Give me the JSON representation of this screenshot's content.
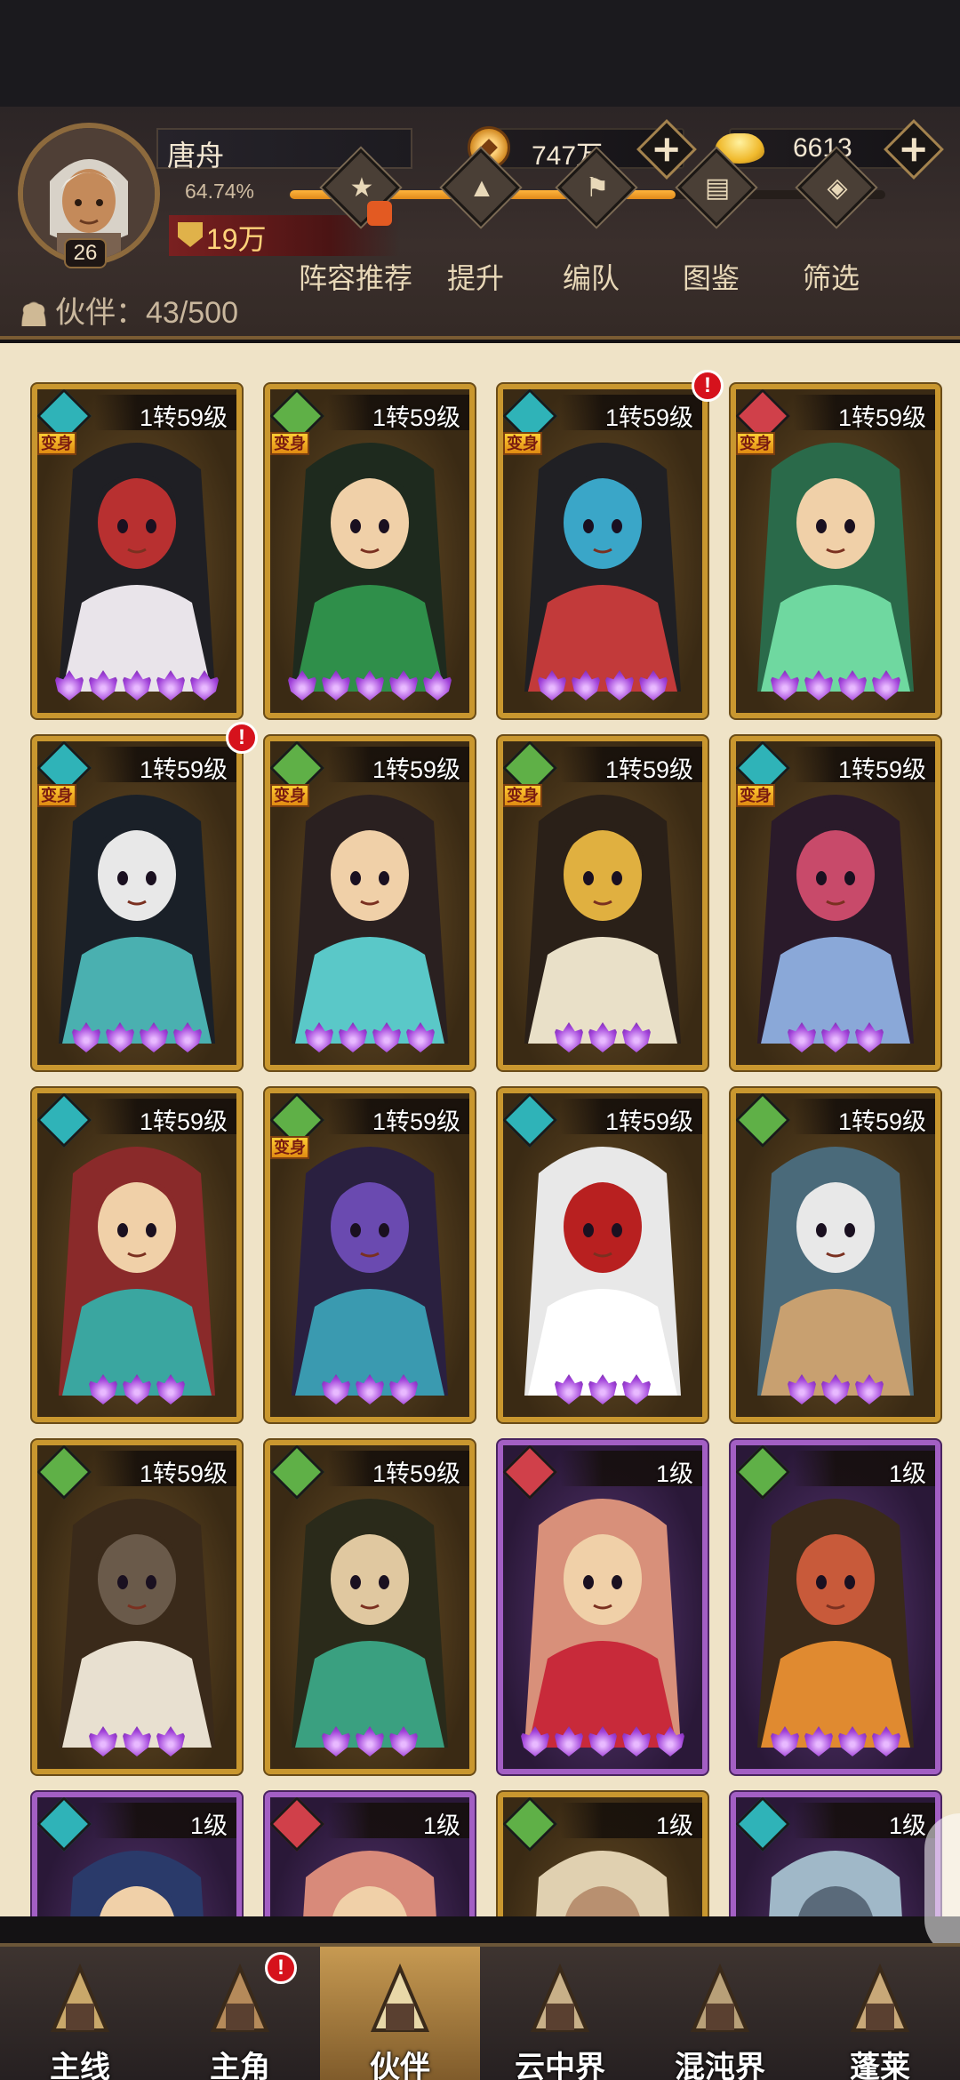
{
  "player": {
    "name": "唐舟",
    "level": "26",
    "exp_percent": "64.74%",
    "exp_fraction": 0.6474,
    "power": "19万"
  },
  "currency": {
    "coins": "747万",
    "ingots": "6613"
  },
  "partners": {
    "label": "伙伴：43/500"
  },
  "actions": [
    {
      "label": "阵容推荐",
      "icon": "recommend-icon"
    },
    {
      "label": "提升",
      "icon": "upgrade-icon"
    },
    {
      "label": "编队",
      "icon": "formation-icon"
    },
    {
      "label": "图鉴",
      "icon": "codex-icon"
    },
    {
      "label": "筛选",
      "icon": "filter-icon"
    }
  ],
  "cards": [
    {
      "level": "1转59级",
      "element": "cyan",
      "transform": "变身",
      "stars": 5,
      "rarity": "gold",
      "alert": false
    },
    {
      "level": "1转59级",
      "element": "green",
      "transform": "变身",
      "stars": 5,
      "rarity": "gold",
      "alert": false
    },
    {
      "level": "1转59级",
      "element": "cyan",
      "transform": "变身",
      "stars": 4,
      "rarity": "gold",
      "alert": true
    },
    {
      "level": "1转59级",
      "element": "red",
      "transform": "变身",
      "stars": 4,
      "rarity": "gold",
      "alert": false
    },
    {
      "level": "1转59级",
      "element": "cyan",
      "transform": "变身",
      "stars": 4,
      "rarity": "gold",
      "alert": true
    },
    {
      "level": "1转59级",
      "element": "green",
      "transform": "变身",
      "stars": 4,
      "rarity": "gold",
      "alert": false
    },
    {
      "level": "1转59级",
      "element": "green",
      "transform": "变身",
      "stars": 3,
      "rarity": "gold",
      "alert": false
    },
    {
      "level": "1转59级",
      "element": "cyan",
      "transform": "变身",
      "stars": 3,
      "rarity": "gold",
      "alert": false
    },
    {
      "level": "1转59级",
      "element": "cyan",
      "transform": "",
      "stars": 3,
      "rarity": "gold",
      "alert": false
    },
    {
      "level": "1转59级",
      "element": "green",
      "transform": "变身",
      "stars": 3,
      "rarity": "gold",
      "alert": false
    },
    {
      "level": "1转59级",
      "element": "cyan",
      "transform": "",
      "stars": 3,
      "rarity": "gold",
      "alert": false
    },
    {
      "level": "1转59级",
      "element": "green",
      "transform": "",
      "stars": 3,
      "rarity": "gold",
      "alert": false
    },
    {
      "level": "1转59级",
      "element": "green",
      "transform": "",
      "stars": 3,
      "rarity": "gold",
      "alert": false
    },
    {
      "level": "1转59级",
      "element": "green",
      "transform": "",
      "stars": 3,
      "rarity": "gold",
      "alert": false
    },
    {
      "level": "1级",
      "element": "red",
      "transform": "",
      "stars": 5,
      "rarity": "purple",
      "alert": false
    },
    {
      "level": "1级",
      "element": "green",
      "transform": "",
      "stars": 4,
      "rarity": "purple",
      "alert": false
    },
    {
      "level": "1级",
      "element": "cyan",
      "transform": "",
      "stars": 0,
      "rarity": "purple",
      "alert": false
    },
    {
      "level": "1级",
      "element": "red",
      "transform": "",
      "stars": 0,
      "rarity": "purple",
      "alert": false
    },
    {
      "level": "1级",
      "element": "green",
      "transform": "",
      "stars": 0,
      "rarity": "gold",
      "alert": false
    },
    {
      "level": "1级",
      "element": "cyan",
      "transform": "",
      "stars": 0,
      "rarity": "purple",
      "alert": false
    }
  ],
  "nav": [
    {
      "label": "主线",
      "icon": "crossed-swords-icon",
      "active": false,
      "alert": false
    },
    {
      "label": "主角",
      "icon": "hero-icon",
      "active": false,
      "alert": true
    },
    {
      "label": "伙伴",
      "icon": "partner-helmet-icon",
      "active": true,
      "alert": false
    },
    {
      "label": "云中界",
      "icon": "pavilion-icon",
      "active": false,
      "alert": false
    },
    {
      "label": "混沌界",
      "icon": "temple-icon",
      "active": false,
      "alert": false
    },
    {
      "label": "蓬莱",
      "icon": "sage-icon",
      "active": false,
      "alert": false
    }
  ],
  "alert_mark": "!",
  "colors": {
    "gold_frame": "#c9972f",
    "purple_frame": "#a35fc4",
    "exp_bar": "#ffb43c",
    "alert": "#d6121c"
  }
}
